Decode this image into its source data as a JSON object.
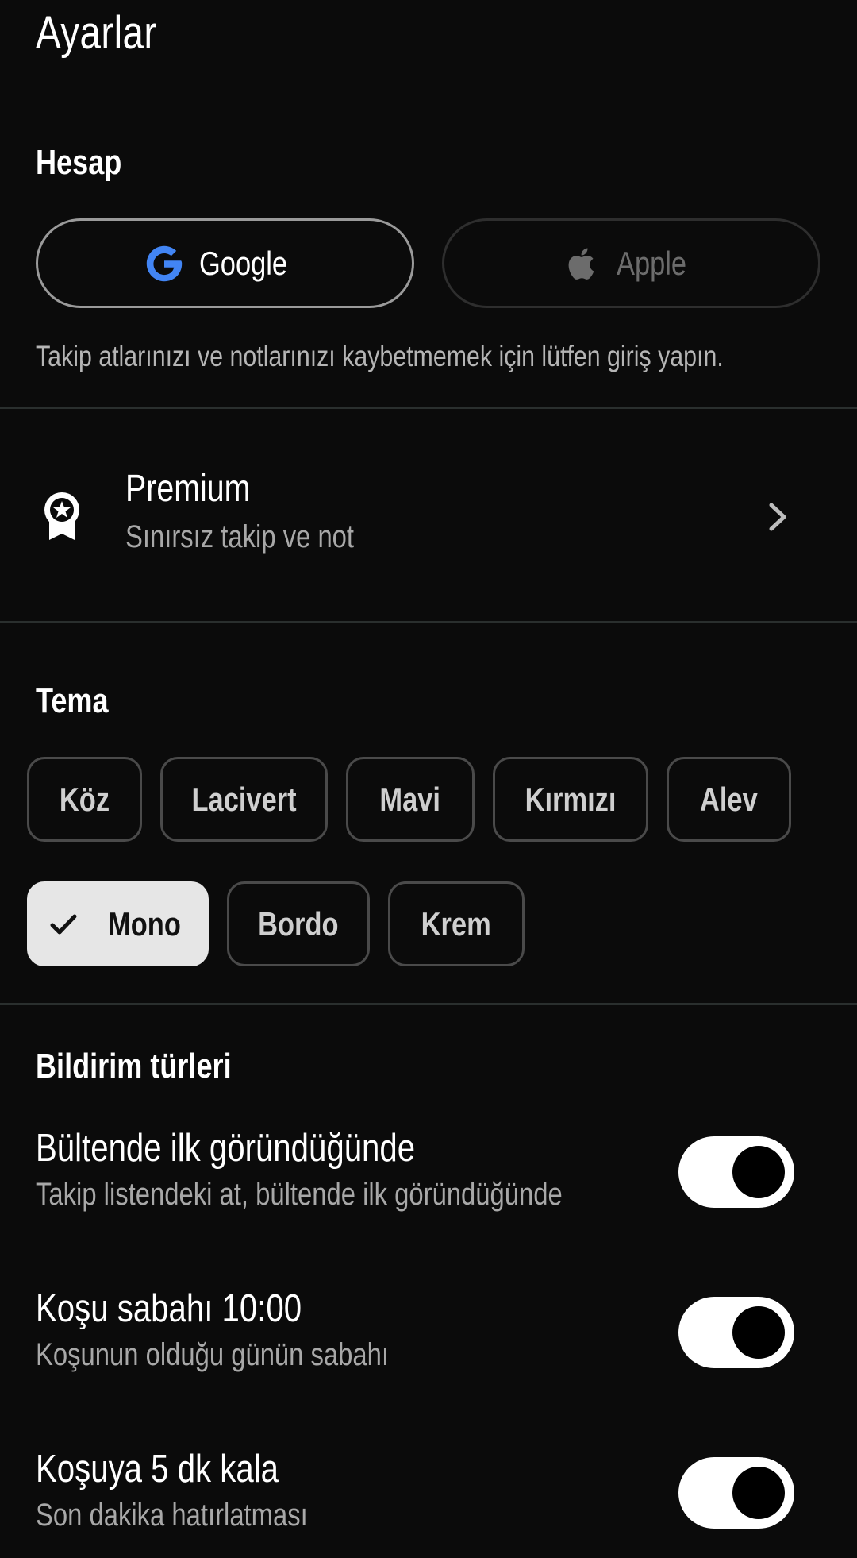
{
  "page": {
    "title": "Ayarlar"
  },
  "account": {
    "heading": "Hesap",
    "google_label": "Google",
    "apple_label": "Apple",
    "hint": "Takip atlarınızı ve notlarınızı kaybetmemek için lütfen giriş yapın."
  },
  "premium": {
    "title": "Premium",
    "subtitle": "Sınırsız takip ve not",
    "icon": "award-ribbon-icon"
  },
  "theme": {
    "heading": "Tema",
    "options": [
      "Köz",
      "Lacivert",
      "Mavi",
      "Kırmızı",
      "Alev",
      "Mono",
      "Bordo",
      "Krem"
    ],
    "selected": "Mono"
  },
  "notifications": {
    "heading": "Bildirim türleri",
    "items": [
      {
        "title": "Bültende ilk göründüğünde",
        "subtitle": "Takip listendeki at, bültende ilk göründüğünde",
        "enabled": true
      },
      {
        "title": "Koşu sabahı 10:00",
        "subtitle": "Koşunun olduğu günün sabahı",
        "enabled": true
      },
      {
        "title": "Koşuya 5 dk kala",
        "subtitle": "Son dakika hatırlatması",
        "enabled": true
      }
    ]
  },
  "colors": {
    "background": "#0b0b0b",
    "google_blue": "#4285F4",
    "selected_chip": "#e6e6e6"
  }
}
